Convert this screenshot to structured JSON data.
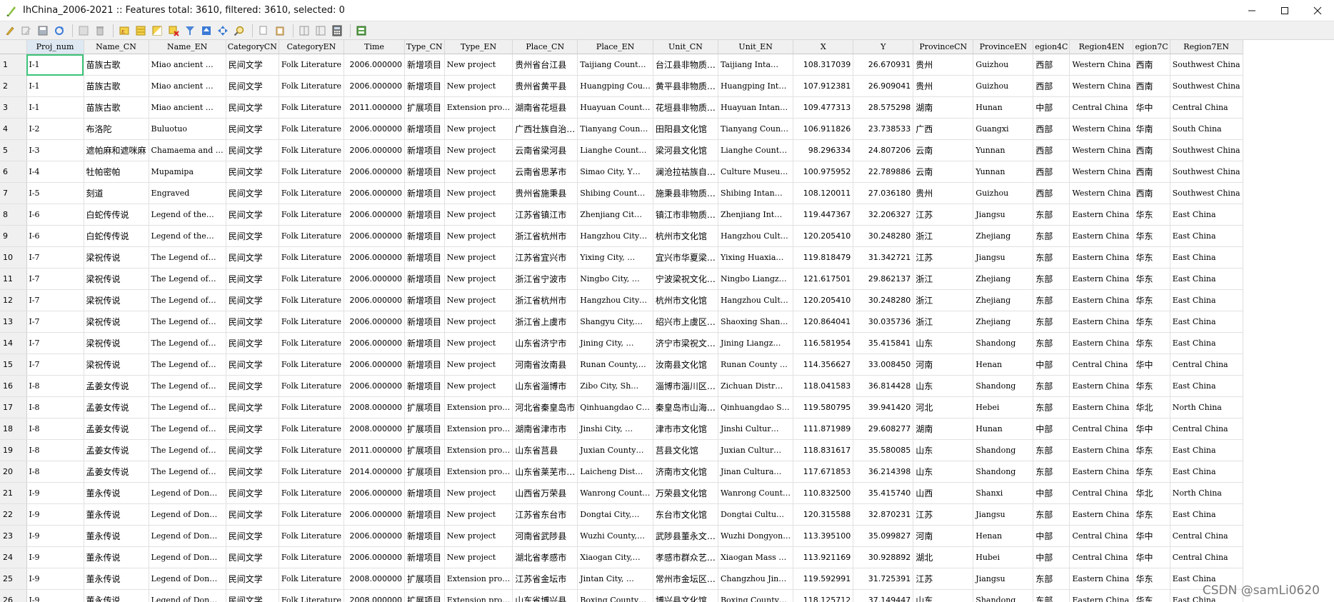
{
  "window": {
    "title": "IhChina_2006-2021 :: Features total: 3610, filtered: 3610, selected: 0"
  },
  "columns": [
    "Proj_num",
    "Name_CN",
    "Name_EN",
    "CategoryCN",
    "CategoryEN",
    "Time",
    "Type_CN",
    "Type_EN",
    "Place_CN",
    "Place_EN",
    "Unit_CN",
    "Unit_EN",
    "X",
    "Y",
    "ProvinceCN",
    "ProvinceEN",
    "egion4C",
    "Region4EN",
    "egion7C",
    "Region7EN"
  ],
  "rows": [
    {
      "n": "1",
      "c": [
        "Ⅰ-1",
        "苗族古歌",
        "Miao ancient …",
        "民间文学",
        "Folk Literature",
        "2006.000000",
        "新增项目",
        "New project",
        "贵州省台江县",
        "Taijiang Count…",
        "台江县非物质…",
        "Taijiang Inta…",
        "108.317039",
        "26.670931",
        "贵州",
        "Guizhou",
        "西部",
        "Western China",
        "西南",
        "Southwest China"
      ]
    },
    {
      "n": "2",
      "c": [
        "Ⅰ-1",
        "苗族古歌",
        "Miao ancient …",
        "民间文学",
        "Folk Literature",
        "2006.000000",
        "新增项目",
        "New project",
        "贵州省黄平县",
        "Huangping Cou…",
        "黄平县非物质…",
        "Huangping Int…",
        "107.912381",
        "26.909041",
        "贵州",
        "Guizhou",
        "西部",
        "Western China",
        "西南",
        "Southwest China"
      ]
    },
    {
      "n": "3",
      "c": [
        "Ⅰ-1",
        "苗族古歌",
        "Miao ancient …",
        "民间文学",
        "Folk Literature",
        "2011.000000",
        "扩展项目",
        "Extension pro…",
        "湖南省花垣县",
        "Huayuan Count…",
        "花垣县非物质…",
        "Huayuan Intan…",
        "109.477313",
        "28.575298",
        "湖南",
        "Hunan",
        "中部",
        "Central China",
        "华中",
        "Central China"
      ]
    },
    {
      "n": "4",
      "c": [
        "Ⅰ-2",
        "布洛陀",
        "Buluotuo",
        "民间文学",
        "Folk Literature",
        "2006.000000",
        "新增项目",
        "New project",
        "广西壮族自治…",
        "Tianyang Coun…",
        "田阳县文化馆",
        "Tianyang Coun…",
        "106.911826",
        "23.738533",
        "广西",
        "Guangxi",
        "西部",
        "Western China",
        "华南",
        "South China"
      ]
    },
    {
      "n": "5",
      "c": [
        "Ⅰ-3",
        "遮帕麻和遮咪麻",
        "Chamaema and …",
        "民间文学",
        "Folk Literature",
        "2006.000000",
        "新增项目",
        "New project",
        "云南省梁河县",
        "Lianghe Count…",
        "梁河县文化馆",
        "Lianghe Count…",
        "98.296334",
        "24.807206",
        "云南",
        "Yunnan",
        "西部",
        "Western China",
        "西南",
        "Southwest China"
      ]
    },
    {
      "n": "6",
      "c": [
        "Ⅰ-4",
        "牡帕密帕",
        "Mupamipa",
        "民间文学",
        "Folk Literature",
        "2006.000000",
        "新增项目",
        "New project",
        "云南省思茅市",
        "Simao City, Y…",
        "澜沧拉祜族自…",
        "Culture Museu…",
        "100.975952",
        "22.789886",
        "云南",
        "Yunnan",
        "西部",
        "Western China",
        "西南",
        "Southwest China"
      ]
    },
    {
      "n": "7",
      "c": [
        "Ⅰ-5",
        "刻道",
        "Engraved",
        "民间文学",
        "Folk Literature",
        "2006.000000",
        "新增项目",
        "New project",
        "贵州省施秉县",
        "Shibing Count…",
        "施秉县非物质…",
        "Shibing Intan…",
        "108.120011",
        "27.036180",
        "贵州",
        "Guizhou",
        "西部",
        "Western China",
        "西南",
        "Southwest China"
      ]
    },
    {
      "n": "8",
      "c": [
        "Ⅰ-6",
        "白蛇传传说",
        "Legend of the…",
        "民间文学",
        "Folk Literature",
        "2006.000000",
        "新增项目",
        "New project",
        "江苏省镇江市",
        "Zhenjiang Cit…",
        "镇江市非物质…",
        "Zhenjiang Int…",
        "119.447367",
        "32.206327",
        "江苏",
        "Jiangsu",
        "东部",
        "Eastern China",
        "华东",
        "East China"
      ]
    },
    {
      "n": "9",
      "c": [
        "Ⅰ-6",
        "白蛇传传说",
        "Legend of the…",
        "民间文学",
        "Folk Literature",
        "2006.000000",
        "新增项目",
        "New project",
        "浙江省杭州市",
        "Hangzhou City…",
        "杭州市文化馆",
        "Hangzhou Cult…",
        "120.205410",
        "30.248280",
        "浙江",
        "Zhejiang",
        "东部",
        "Eastern China",
        "华东",
        "East China"
      ]
    },
    {
      "n": "10",
      "c": [
        "Ⅰ-7",
        "梁祝传说",
        "The Legend of…",
        "民间文学",
        "Folk Literature",
        "2006.000000",
        "新增项目",
        "New project",
        "江苏省宜兴市",
        "Yixing City, …",
        "宜兴市华夏梁…",
        "Yixing Huaxia…",
        "119.818479",
        "31.342721",
        "江苏",
        "Jiangsu",
        "东部",
        "Eastern China",
        "华东",
        "East China"
      ]
    },
    {
      "n": "11",
      "c": [
        "Ⅰ-7",
        "梁祝传说",
        "The Legend of…",
        "民间文学",
        "Folk Literature",
        "2006.000000",
        "新增项目",
        "New project",
        "浙江省宁波市",
        "Ningbo City, …",
        "宁波梁祝文化…",
        "Ningbo Liangz…",
        "121.617501",
        "29.862137",
        "浙江",
        "Zhejiang",
        "东部",
        "Eastern China",
        "华东",
        "East China"
      ]
    },
    {
      "n": "12",
      "c": [
        "Ⅰ-7",
        "梁祝传说",
        "The Legend of…",
        "民间文学",
        "Folk Literature",
        "2006.000000",
        "新增项目",
        "New project",
        "浙江省杭州市",
        "Hangzhou City…",
        "杭州市文化馆",
        "Hangzhou Cult…",
        "120.205410",
        "30.248280",
        "浙江",
        "Zhejiang",
        "东部",
        "Eastern China",
        "华东",
        "East China"
      ]
    },
    {
      "n": "13",
      "c": [
        "Ⅰ-7",
        "梁祝传说",
        "The Legend of…",
        "民间文学",
        "Folk Literature",
        "2006.000000",
        "新增项目",
        "New project",
        "浙江省上虞市",
        "Shangyu City,…",
        "绍兴市上虞区…",
        "Shaoxing Shan…",
        "120.864041",
        "30.035736",
        "浙江",
        "Zhejiang",
        "东部",
        "Eastern China",
        "华东",
        "East China"
      ]
    },
    {
      "n": "14",
      "c": [
        "Ⅰ-7",
        "梁祝传说",
        "The Legend of…",
        "民间文学",
        "Folk Literature",
        "2006.000000",
        "新增项目",
        "New project",
        "山东省济宁市",
        "Jining City, …",
        "济宁市梁祝文…",
        "Jining Liangz…",
        "116.581954",
        "35.415841",
        "山东",
        "Shandong",
        "东部",
        "Eastern China",
        "华东",
        "East China"
      ]
    },
    {
      "n": "15",
      "c": [
        "Ⅰ-7",
        "梁祝传说",
        "The Legend of…",
        "民间文学",
        "Folk Literature",
        "2006.000000",
        "新增项目",
        "New project",
        "河南省汝南县",
        "Runan County,…",
        "汝南县文化馆",
        "Runan County …",
        "114.356627",
        "33.008450",
        "河南",
        "Henan",
        "中部",
        "Central China",
        "华中",
        "Central China"
      ]
    },
    {
      "n": "16",
      "c": [
        "Ⅰ-8",
        "孟姜女传说",
        "The Legend of…",
        "民间文学",
        "Folk Literature",
        "2006.000000",
        "新增项目",
        "New project",
        "山东省淄博市",
        "Zibo City, Sh…",
        "淄博市淄川区…",
        "Zichuan Distr…",
        "118.041583",
        "36.814428",
        "山东",
        "Shandong",
        "东部",
        "Eastern China",
        "华东",
        "East China"
      ]
    },
    {
      "n": "17",
      "c": [
        "Ⅰ-8",
        "孟姜女传说",
        "The Legend of…",
        "民间文学",
        "Folk Literature",
        "2008.000000",
        "扩展项目",
        "Extension pro…",
        "河北省秦皇岛市",
        "Qinhuangdao C…",
        "秦皇岛市山海…",
        "Qinhuangdao S…",
        "119.580795",
        "39.941420",
        "河北",
        "Hebei",
        "东部",
        "Eastern China",
        "华北",
        "North China"
      ]
    },
    {
      "n": "18",
      "c": [
        "Ⅰ-8",
        "孟姜女传说",
        "The Legend of…",
        "民间文学",
        "Folk Literature",
        "2008.000000",
        "扩展项目",
        "Extension pro…",
        "湖南省津市市",
        "Jinshi City, …",
        "津市市文化馆",
        "Jinshi Cultur…",
        "111.871989",
        "29.608277",
        "湖南",
        "Hunan",
        "中部",
        "Central China",
        "华中",
        "Central China"
      ]
    },
    {
      "n": "19",
      "c": [
        "Ⅰ-8",
        "孟姜女传说",
        "The Legend of…",
        "民间文学",
        "Folk Literature",
        "2011.000000",
        "扩展项目",
        "Extension pro…",
        "山东省莒县",
        "Juxian County…",
        "莒县文化馆",
        "Juxian Cultur…",
        "118.831617",
        "35.580085",
        "山东",
        "Shandong",
        "东部",
        "Eastern China",
        "华东",
        "East China"
      ]
    },
    {
      "n": "20",
      "c": [
        "Ⅰ-8",
        "孟姜女传说",
        "The Legend of…",
        "民间文学",
        "Folk Literature",
        "2014.000000",
        "扩展项目",
        "Extension pro…",
        "山东省莱芜市…",
        "Laicheng Dist…",
        "济南市文化馆",
        "Jinan Cultura…",
        "117.671853",
        "36.214398",
        "山东",
        "Shandong",
        "东部",
        "Eastern China",
        "华东",
        "East China"
      ]
    },
    {
      "n": "21",
      "c": [
        "Ⅰ-9",
        "董永传说",
        "Legend of Don…",
        "民间文学",
        "Folk Literature",
        "2006.000000",
        "新增项目",
        "New project",
        "山西省万荣县",
        "Wanrong Count…",
        "万荣县文化馆",
        "Wanrong Count…",
        "110.832500",
        "35.415740",
        "山西",
        "Shanxi",
        "中部",
        "Central China",
        "华北",
        "North China"
      ]
    },
    {
      "n": "22",
      "c": [
        "Ⅰ-9",
        "董永传说",
        "Legend of Don…",
        "民间文学",
        "Folk Literature",
        "2006.000000",
        "新增项目",
        "New project",
        "江苏省东台市",
        "Dongtai City,…",
        "东台市文化馆",
        "Dongtai Cultu…",
        "120.315588",
        "32.870231",
        "江苏",
        "Jiangsu",
        "东部",
        "Eastern China",
        "华东",
        "East China"
      ]
    },
    {
      "n": "23",
      "c": [
        "Ⅰ-9",
        "董永传说",
        "Legend of Don…",
        "民间文学",
        "Folk Literature",
        "2006.000000",
        "新增项目",
        "New project",
        "河南省武陟县",
        "Wuzhi County,…",
        "武陟县董永文…",
        "Wuzhi Dongyon…",
        "113.395100",
        "35.099827",
        "河南",
        "Henan",
        "中部",
        "Central China",
        "华中",
        "Central China"
      ]
    },
    {
      "n": "24",
      "c": [
        "Ⅰ-9",
        "董永传说",
        "Legend of Don…",
        "民间文学",
        "Folk Literature",
        "2006.000000",
        "新增项目",
        "New project",
        "湖北省孝感市",
        "Xiaogan City,…",
        "孝感市群众艺…",
        "Xiaogan Mass …",
        "113.921169",
        "30.928892",
        "湖北",
        "Hubei",
        "中部",
        "Central China",
        "华中",
        "Central China"
      ]
    },
    {
      "n": "25",
      "c": [
        "Ⅰ-9",
        "董永传说",
        "Legend of Don…",
        "民间文学",
        "Folk Literature",
        "2008.000000",
        "扩展项目",
        "Extension pro…",
        "江苏省金坛市",
        "Jintan City, …",
        "常州市金坛区…",
        "Changzhou Jin…",
        "119.592991",
        "31.725391",
        "江苏",
        "Jiangsu",
        "东部",
        "Eastern China",
        "华东",
        "East China"
      ]
    },
    {
      "n": "26",
      "c": [
        "Ⅰ-9",
        "董永传说",
        "Legend of Don…",
        "民间文学",
        "Folk Literature",
        "2008.000000",
        "扩展项目",
        "Extension pro…",
        "山东省博兴县",
        "Boxing County…",
        "博兴县文化馆",
        "Boxing County…",
        "118.125712",
        "37.149447",
        "山东",
        "Shandong",
        "东部",
        "Eastern China",
        "华东",
        "East China"
      ]
    }
  ],
  "watermark": "CSDN @samLi0620"
}
